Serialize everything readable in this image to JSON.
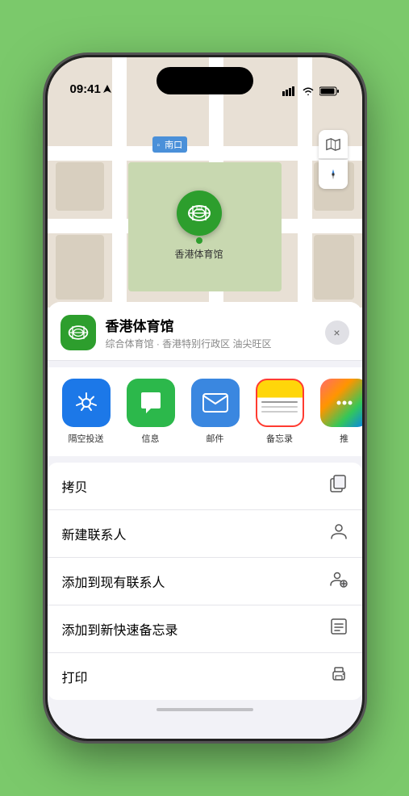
{
  "statusBar": {
    "time": "09:41",
    "locationIcon": "▶"
  },
  "mapControls": {
    "mapIcon": "🗺",
    "locationIcon": "➤"
  },
  "mapLabel": {
    "text": "南口"
  },
  "venuePinLabel": "香港体育馆",
  "sheet": {
    "venueName": "香港体育馆",
    "venueDesc": "综合体育馆 · 香港特别行政区 油尖旺区",
    "closeLabel": "×"
  },
  "shareItems": [
    {
      "id": "airdrop",
      "label": "隔空投送",
      "type": "airdrop"
    },
    {
      "id": "message",
      "label": "信息",
      "type": "message"
    },
    {
      "id": "mail",
      "label": "邮件",
      "type": "mail"
    },
    {
      "id": "notes",
      "label": "备忘录",
      "type": "notes",
      "selected": true
    },
    {
      "id": "more",
      "label": "推",
      "type": "more"
    }
  ],
  "actionItems": [
    {
      "id": "copy",
      "label": "拷贝",
      "icon": "⎘"
    },
    {
      "id": "new-contact",
      "label": "新建联系人",
      "icon": "👤"
    },
    {
      "id": "add-existing",
      "label": "添加到现有联系人",
      "icon": "👤+"
    },
    {
      "id": "add-notes",
      "label": "添加到新快速备忘录",
      "icon": "📝"
    },
    {
      "id": "print",
      "label": "打印",
      "icon": "🖨"
    }
  ]
}
